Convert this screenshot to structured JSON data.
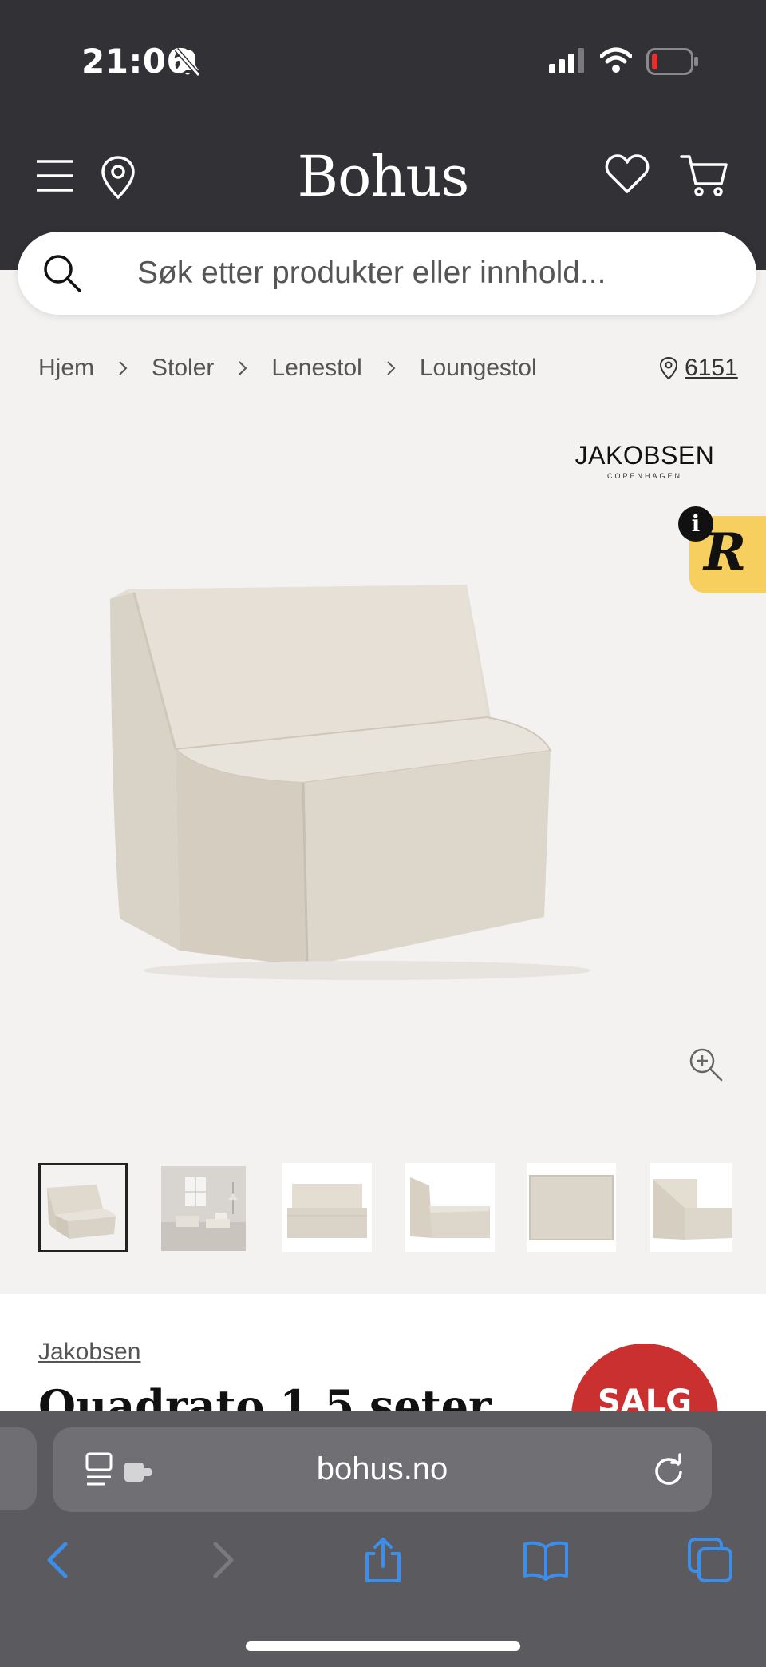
{
  "status": {
    "time": "21:06"
  },
  "header": {
    "logo": "Bohus",
    "icons": [
      "menu-icon",
      "location-pin-icon",
      "heart-icon",
      "cart-icon"
    ]
  },
  "search": {
    "placeholder": "Søk etter produkter eller innhold..."
  },
  "breadcrumbs": [
    {
      "label": "Hjem"
    },
    {
      "label": "Stoler"
    },
    {
      "label": "Lenestol"
    },
    {
      "label": "Loungestol"
    }
  ],
  "store": {
    "number": "6151"
  },
  "brand_logo": {
    "name": "JAKOBSEN",
    "sub": "COPENHAGEN"
  },
  "badge": {
    "letter": "R",
    "info": "i",
    "color": "#f7cf5e"
  },
  "product": {
    "brand": "Jakobsen",
    "title": "Quadrato 1,5 seter",
    "sale_label": "SALG",
    "thumbnail_count": 6
  },
  "browser": {
    "url": "bohus.no"
  },
  "colors": {
    "header_bg": "#323136",
    "sale_red": "#c9302f",
    "page_bg": "#f4f2f0",
    "safari_blue": "#3c8ee8"
  }
}
